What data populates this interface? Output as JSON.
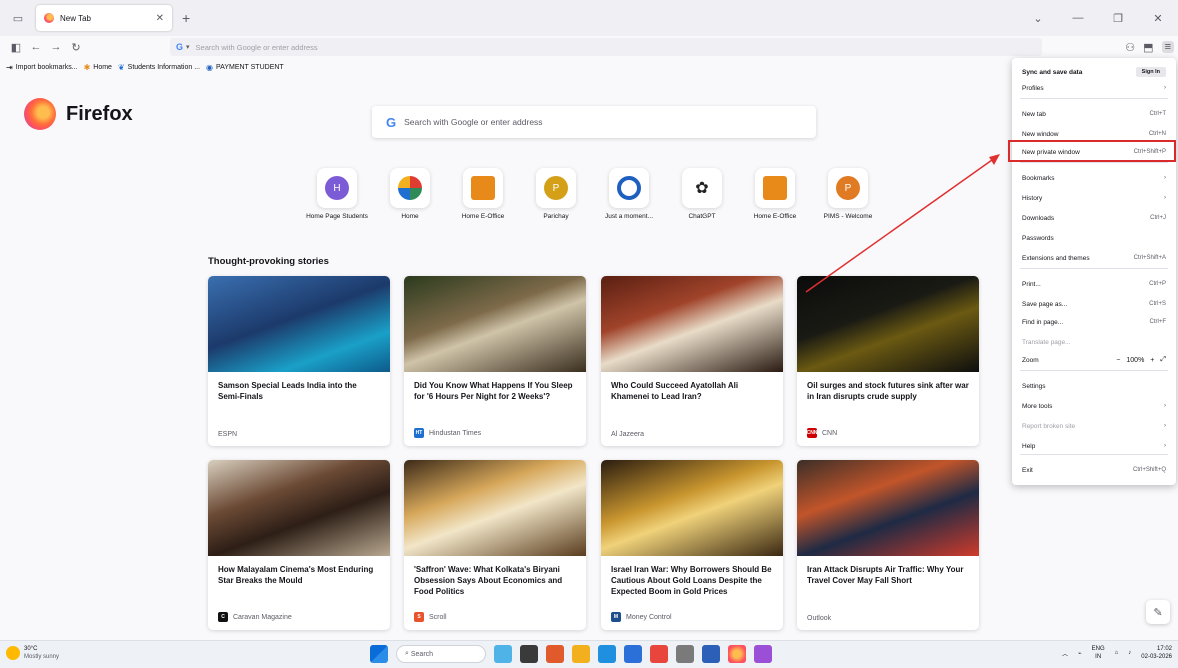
{
  "browser": {
    "tab_title": "New Tab",
    "url_placeholder": "Search with Google or enter address"
  },
  "bookmarks": [
    {
      "label": "Import bookmarks...",
      "icon": "import-icon"
    },
    {
      "label": "Home",
      "icon": "emblem-icon"
    },
    {
      "label": "Students Information ...",
      "icon": "leaf-icon"
    },
    {
      "label": "PAYMENT STUDENT",
      "icon": "globe-icon"
    }
  ],
  "newtab": {
    "brand": "Firefox",
    "search_placeholder": "Search with Google or enter address",
    "shortcuts": [
      {
        "label": "Home Page Students",
        "letter": "H",
        "color": "#7b5cd6"
      },
      {
        "label": "Home",
        "letter": "",
        "color": "#e03c31"
      },
      {
        "label": "Home E-Office",
        "letter": "",
        "color": "#e88a1a"
      },
      {
        "label": "Parichay",
        "letter": "P",
        "color": "#d4a017"
      },
      {
        "label": "Just a moment...",
        "letter": "",
        "color": "#1f5fbf"
      },
      {
        "label": "ChatGPT",
        "letter": "",
        "color": "#222222"
      },
      {
        "label": "Home E-Office",
        "letter": "",
        "color": "#e88a1a"
      },
      {
        "label": "PIMS - Welcome",
        "letter": "P",
        "color": "#e07b23"
      }
    ],
    "stories_title": "Thought-provoking stories",
    "stories": [
      {
        "headline": "Samson Special Leads India into the Semi-Finals",
        "source": "ESPN",
        "source_badge": "",
        "badge_color": "",
        "img": "linear-gradient(160deg,#3a6fb0 0%,#1c3a6b 45%,#1aa0c8 75%,#0d5a8a 100%)"
      },
      {
        "headline": "Did You Know What Happens If You Sleep for '6 Hours Per Night for 2 Weeks'?",
        "source": "Hindustan Times",
        "source_badge": "HT",
        "badge_color": "#1f6fd1",
        "img": "linear-gradient(160deg,#2b3a1d 0%,#7d6a4a 40%,#cfc3a8 55%,#3a2e1f 100%)"
      },
      {
        "headline": "Who Could Succeed Ayatollah Ali Khamenei to Lead Iran?",
        "source": "Al Jazeera",
        "source_badge": "",
        "badge_color": "",
        "img": "linear-gradient(160deg,#5a1f12 0%,#a0432a 35%,#e8dcc8 55%,#2a1a12 100%)"
      },
      {
        "headline": "Oil surges and stock futures sink after war in Iran disrupts crude supply",
        "source": "CNN",
        "source_badge": "CNN",
        "badge_color": "#cc0000",
        "img": "linear-gradient(160deg,#0b0b0b 0%,#1a1a14 40%,#6b5a12 60%,#0e0e0e 100%)"
      },
      {
        "headline": "How Malayalam Cinema's Most Enduring Star Breaks the Mould",
        "source": "Caravan Magazine",
        "source_badge": "C",
        "badge_color": "#111111",
        "img": "linear-gradient(160deg,#d9cfbf 0%,#6b4a35 35%,#2d1e16 60%,#b8a890 100%)"
      },
      {
        "headline": "'Saffron' Wave: What Kolkata's Biryani Obsession Says About Economics and Food Politics",
        "source": "Scroll",
        "source_badge": "S",
        "badge_color": "#e8532d",
        "img": "linear-gradient(160deg,#3c2a18 0%,#d6a75a 35%,#f2e6c8 55%,#5a3c1e 100%)"
      },
      {
        "headline": "Israel Iran War: Why Borrowers Should Be Cautious About Gold Loans Despite the Expected Boom in Gold Prices",
        "source": "Money Control",
        "source_badge": "M",
        "badge_color": "#1f4e8c",
        "img": "linear-gradient(160deg,#2a1c10 0%,#c9962f 40%,#f0d27a 55%,#3a2812 100%)"
      },
      {
        "headline": "Iran Attack Disrupts Air Traffic: Why Your Travel Cover May Fall Short",
        "source": "Outlook",
        "source_badge": "",
        "badge_color": "",
        "img": "linear-gradient(160deg,#3b2e28 0%,#c2552a 35%,#1e2a44 60%,#cf3b2b 100%)"
      }
    ]
  },
  "menu": {
    "sync": "Sync and save data",
    "sign_in": "Sign In",
    "items": [
      {
        "label": "Profiles",
        "shortcut": "›",
        "dim": false
      },
      {
        "label": "New tab",
        "shortcut": "Ctrl+T",
        "dim": false
      },
      {
        "label": "New window",
        "shortcut": "Ctrl+N",
        "dim": false
      },
      {
        "label": "New private window",
        "shortcut": "Ctrl+Shift+P",
        "dim": false
      },
      {
        "label": "Bookmarks",
        "shortcut": "›",
        "dim": false
      },
      {
        "label": "History",
        "shortcut": "›",
        "dim": false
      },
      {
        "label": "Downloads",
        "shortcut": "Ctrl+J",
        "dim": false
      },
      {
        "label": "Passwords",
        "shortcut": "",
        "dim": false
      },
      {
        "label": "Extensions and themes",
        "shortcut": "Ctrl+Shift+A",
        "dim": false
      },
      {
        "label": "Print...",
        "shortcut": "Ctrl+P",
        "dim": false
      },
      {
        "label": "Save page as...",
        "shortcut": "Ctrl+S",
        "dim": false
      },
      {
        "label": "Find in page...",
        "shortcut": "Ctrl+F",
        "dim": false
      },
      {
        "label": "Translate page...",
        "shortcut": "",
        "dim": true
      },
      {
        "label": "Zoom",
        "shortcut": "",
        "dim": false
      },
      {
        "label": "Settings",
        "shortcut": "",
        "dim": false
      },
      {
        "label": "More tools",
        "shortcut": "›",
        "dim": false
      },
      {
        "label": "Report broken site",
        "shortcut": "›",
        "dim": true
      },
      {
        "label": "Help",
        "shortcut": "›",
        "dim": false
      },
      {
        "label": "Exit",
        "shortcut": "Ctrl+Shift+Q",
        "dim": false
      }
    ],
    "zoom_level": "100%",
    "highlight_color": "#d92b2b"
  },
  "taskbar": {
    "temperature": "30°C",
    "weather": "Mostly sunny",
    "search_placeholder": "Search",
    "language": "ENG",
    "region": "IN",
    "time": "17:02",
    "date": "02-03-2026"
  }
}
